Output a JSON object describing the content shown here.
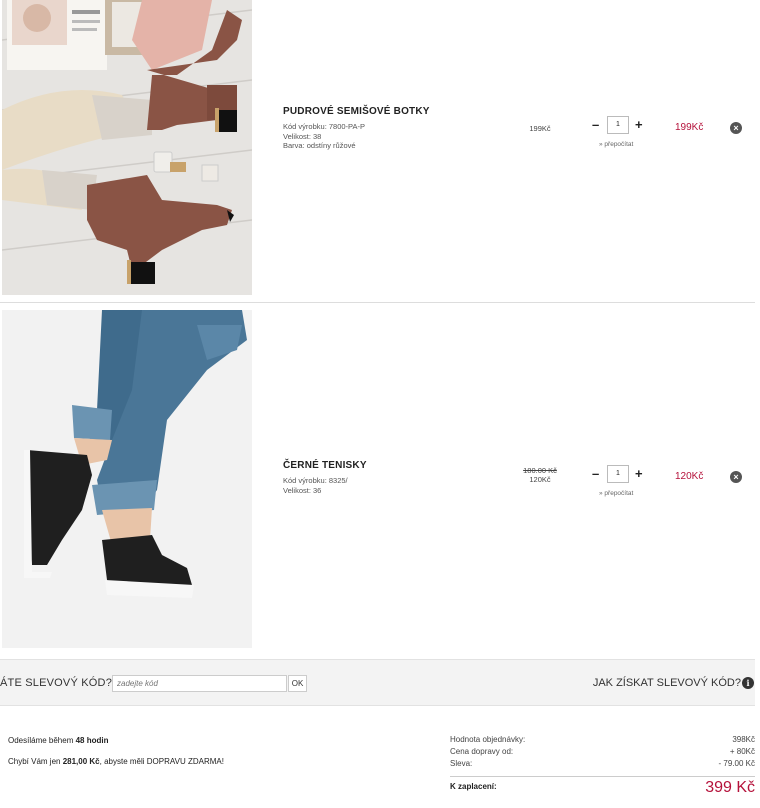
{
  "items": [
    {
      "name": "PUDROVÉ SEMIŠOVÉ BOTKY",
      "code": "Kód výrobku: 7800-PA-P",
      "size": "Velikost: 38",
      "color": "Barva: odstíny růžové",
      "unit_price": "199Kč",
      "qty": "1",
      "qty_minus": "–",
      "qty_plus": "+",
      "recalc": "» přepočítat",
      "total": "199Kč",
      "image": "brown suede ankle boots"
    },
    {
      "name": "ČERNÉ TENISKY",
      "code": "Kód výrobku: 8325/",
      "size": "Velikost: 36",
      "old_price": "180.00 Kč",
      "unit_price": "120Kč",
      "qty": "1",
      "qty_minus": "–",
      "qty_plus": "+",
      "recalc": "» přepočítat",
      "total": "120Kč",
      "image": "black slip-on sneakers"
    }
  ],
  "coupon": {
    "label": "ÁTE SLEVOVÝ KÓD?",
    "placeholder": "zadejte kód",
    "ok": "OK",
    "howto": "JAK ZÍSKAT SLEVOVÝ KÓD?"
  },
  "shipping": {
    "line1_pre": "Odesíláme během",
    "line1_bold": "48 hodin",
    "line2_pre": "Chybí Vám jen",
    "line2_bold": "281,00 Kč",
    "line2_post": ", abyste měli DOPRAVU ZDARMA!"
  },
  "summary": {
    "order_label": "Hodnota objednávky:",
    "order_value": "398Kč",
    "delivery_label": "Cena dopravy od:",
    "delivery_value": "+ 80Kč",
    "discount_label": "Sleva:",
    "discount_value": "- 79.00 Kč",
    "pay_label": "K zaplacení:",
    "pay_value": "399 Kč"
  },
  "colors": {
    "accent": "#b5123b"
  },
  "icons": [
    "remove-icon",
    "info-icon"
  ]
}
